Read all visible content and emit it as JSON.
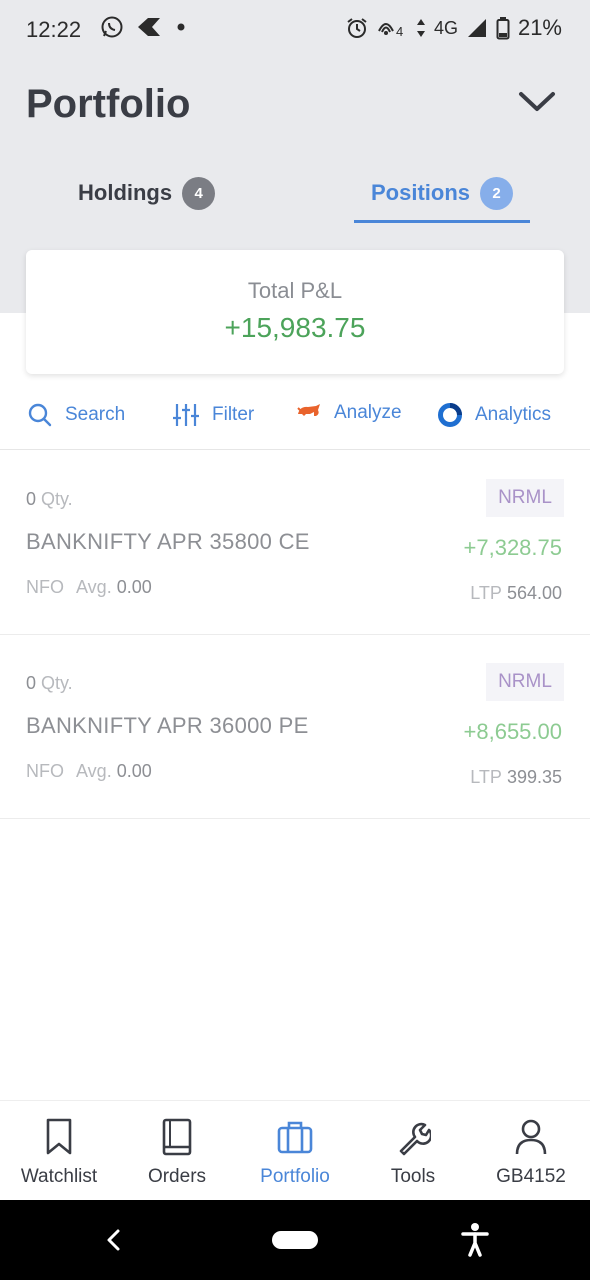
{
  "status_bar": {
    "time": "12:22",
    "network": "4G",
    "battery": "21%",
    "icons": [
      "whatsapp-icon",
      "app-icon",
      "dot-icon",
      "alarm-icon",
      "hotspot-icon",
      "data-arrows-icon",
      "signal-icon",
      "battery-icon"
    ]
  },
  "header": {
    "title": "Portfolio"
  },
  "tabs": [
    {
      "label": "Holdings",
      "count": "4",
      "active": false
    },
    {
      "label": "Positions",
      "count": "2",
      "active": true
    }
  ],
  "summary": {
    "label": "Total P&L",
    "value": "+15,983.75",
    "value_color": "#4ca35a"
  },
  "actions": [
    {
      "label": "Search",
      "icon": "search-icon"
    },
    {
      "label": "Filter",
      "icon": "filter-sliders-icon"
    },
    {
      "label": "Analyze",
      "icon": "analyze-bull-icon"
    },
    {
      "label": "Analytics",
      "icon": "analytics-ring-icon"
    }
  ],
  "positions": [
    {
      "qty": "0",
      "qty_label": "Qty.",
      "symbol": "BANKNIFTY APR 35800 CE",
      "exchange": "NFO",
      "avg_label": "Avg.",
      "avg": "0.00",
      "product": "NRML",
      "pnl": "+7,328.75",
      "ltp_label": "LTP",
      "ltp": "564.00"
    },
    {
      "qty": "0",
      "qty_label": "Qty.",
      "symbol": "BANKNIFTY APR 36000 PE",
      "exchange": "NFO",
      "avg_label": "Avg.",
      "avg": "0.00",
      "product": "NRML",
      "pnl": "+8,655.00",
      "ltp_label": "LTP",
      "ltp": "399.35"
    }
  ],
  "bottom_nav": [
    {
      "label": "Watchlist",
      "icon": "bookmark-icon",
      "active": false
    },
    {
      "label": "Orders",
      "icon": "book-icon",
      "active": false
    },
    {
      "label": "Portfolio",
      "icon": "briefcase-icon",
      "active": true
    },
    {
      "label": "Tools",
      "icon": "wrench-icon",
      "active": false
    },
    {
      "label": "GB4152",
      "icon": "user-icon",
      "active": false
    }
  ],
  "colors": {
    "accent": "#4a86d8",
    "profit": "#4ca35a",
    "profit_light": "#8dcb92",
    "header_bg": "#e9eaed",
    "product_text": "#a992c8"
  }
}
